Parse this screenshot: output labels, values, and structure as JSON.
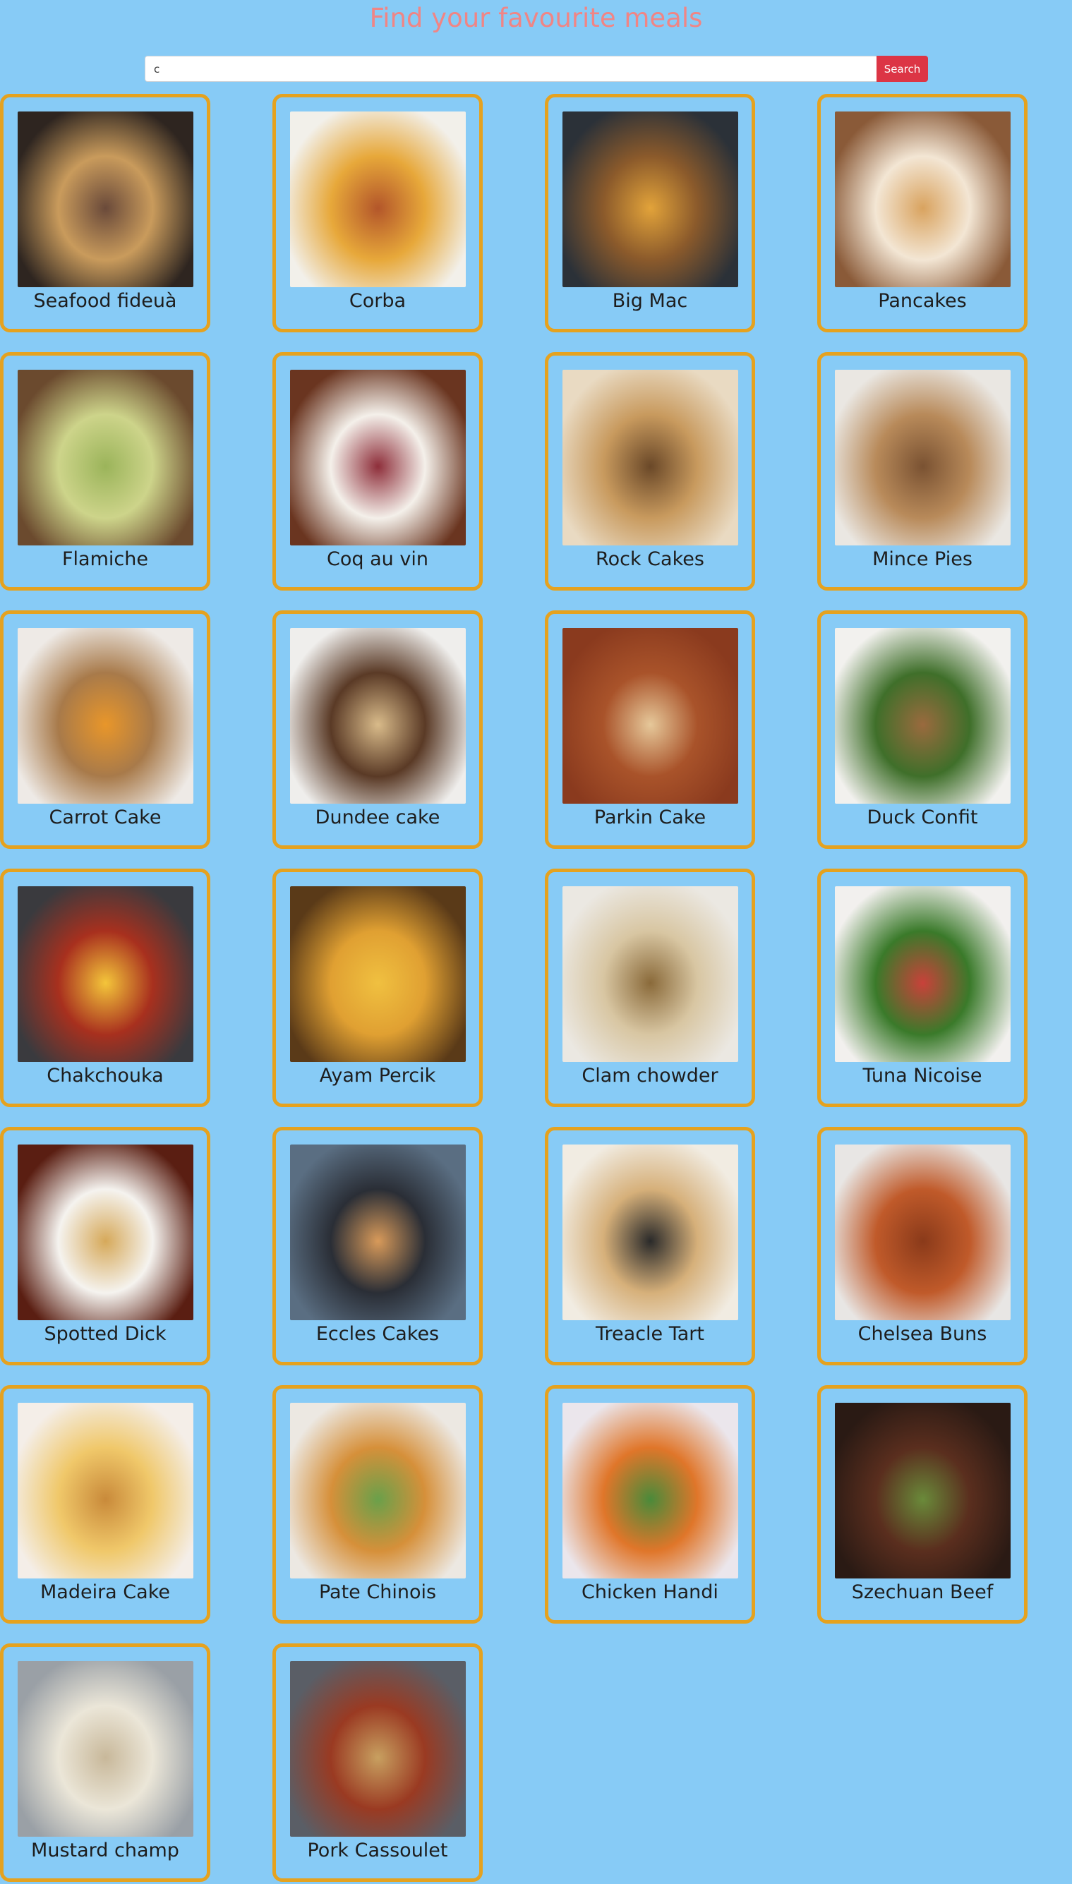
{
  "page": {
    "title": "Find your favourite meals"
  },
  "search": {
    "value": "c",
    "button_label": "Search"
  },
  "meals": [
    {
      "name": "Seafood fideuà",
      "colors": [
        "#2e2520",
        "#c99b5c",
        "#6a4a3a"
      ]
    },
    {
      "name": "Corba",
      "colors": [
        "#f2f0ea",
        "#e7a83a",
        "#b3562a"
      ]
    },
    {
      "name": "Big Mac",
      "colors": [
        "#2b3138",
        "#8b5a2b",
        "#e2a33a"
      ]
    },
    {
      "name": "Pancakes",
      "colors": [
        "#8a5a38",
        "#f3e6d4",
        "#d9a35f"
      ]
    },
    {
      "name": "Flamiche",
      "colors": [
        "#6b4a2e",
        "#cdd48a",
        "#9bb45a"
      ]
    },
    {
      "name": "Coq au vin",
      "colors": [
        "#6a3520",
        "#f4f0ea",
        "#8e2e3a"
      ]
    },
    {
      "name": "Rock Cakes",
      "colors": [
        "#e9dac2",
        "#c89a5e",
        "#6a4828"
      ]
    },
    {
      "name": "Mince Pies",
      "colors": [
        "#eae7e2",
        "#b88a5a",
        "#7a5232"
      ]
    },
    {
      "name": "Carrot Cake",
      "colors": [
        "#eeeae6",
        "#a87a4a",
        "#e8962a"
      ]
    },
    {
      "name": "Dundee cake",
      "colors": [
        "#efeeec",
        "#5a3a26",
        "#d9bb8a"
      ]
    },
    {
      "name": "Parkin Cake",
      "colors": [
        "#8a3a1e",
        "#a9532a",
        "#e6c89a"
      ]
    },
    {
      "name": "Duck Confit",
      "colors": [
        "#f2f1ee",
        "#3f6f2a",
        "#9a6a3e"
      ]
    },
    {
      "name": "Chakchouka",
      "colors": [
        "#3a3a3e",
        "#a8301e",
        "#f4c53a"
      ]
    },
    {
      "name": "Ayam Percik",
      "colors": [
        "#5a3a18",
        "#e0a032",
        "#f0c040"
      ]
    },
    {
      "name": "Clam chowder",
      "colors": [
        "#ebe8e2",
        "#d8c6a2",
        "#8a6a3a"
      ]
    },
    {
      "name": "Tuna Nicoise",
      "colors": [
        "#f2f0ee",
        "#3a7a2a",
        "#c9413a"
      ]
    },
    {
      "name": "Spotted Dick",
      "colors": [
        "#5a1e12",
        "#f5f3ef",
        "#d6a95a"
      ]
    },
    {
      "name": "Eccles Cakes",
      "colors": [
        "#5a6e82",
        "#2a2e36",
        "#d89a5a"
      ]
    },
    {
      "name": "Treacle Tart",
      "colors": [
        "#f1ece2",
        "#d6b07a",
        "#2a2a2a"
      ]
    },
    {
      "name": "Chelsea Buns",
      "colors": [
        "#e8e6e4",
        "#c05a2a",
        "#8a3a1a"
      ]
    },
    {
      "name": "Madeira Cake",
      "colors": [
        "#f4eee8",
        "#f0c86a",
        "#c98a3a"
      ]
    },
    {
      "name": "Pate Chinois",
      "colors": [
        "#ece8e2",
        "#d6903a",
        "#6aa04a"
      ]
    },
    {
      "name": "Chicken Handi",
      "colors": [
        "#ebe6ec",
        "#e0762a",
        "#4a8a3a"
      ]
    },
    {
      "name": "Szechuan Beef",
      "colors": [
        "#2a1a14",
        "#5a2e1e",
        "#6a8a3a"
      ]
    },
    {
      "name": "Mustard champ",
      "colors": [
        "#9aa0a6",
        "#ebe6d8",
        "#c8b89a"
      ]
    },
    {
      "name": "Pork Cassoulet",
      "colors": [
        "#5a5e66",
        "#9a3a22",
        "#c8a060"
      ]
    }
  ]
}
